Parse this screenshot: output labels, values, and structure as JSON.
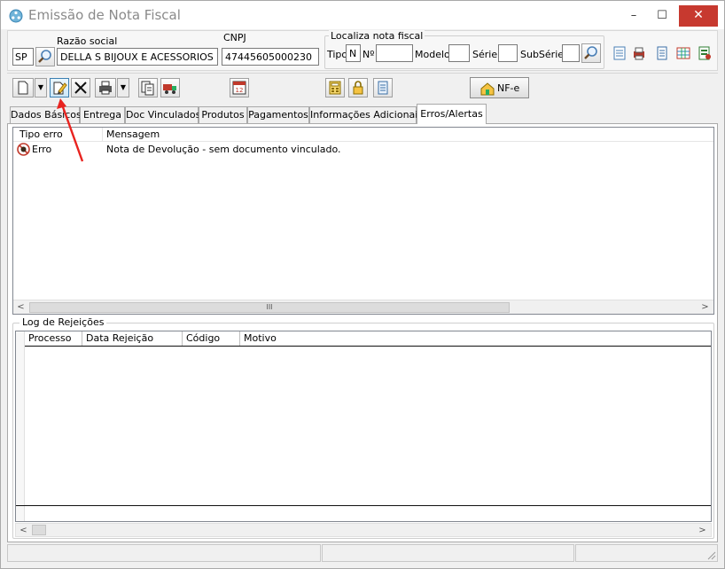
{
  "window": {
    "title": "Emissão de Nota Fiscal",
    "minimize": "–",
    "maximize": "☐",
    "close": "✕"
  },
  "header": {
    "uf": "SP",
    "razao_label": "Razão social",
    "razao_value": "DELLA S BIJOUX E ACESSORIOS LTD",
    "cnpj_label": "CNPJ",
    "cnpj_value": "47445605000230",
    "localiza": {
      "title": "Localiza nota fiscal",
      "tipo_label": "Tipo",
      "tipo_value": "N",
      "numero_label": "Nº",
      "modelo_label": "Modelo",
      "serie_label": "Série",
      "subserie_label": "SubSérie"
    }
  },
  "toolbar": {
    "nfe_label": "NF-e"
  },
  "tabs": [
    {
      "label": "Dados Básicos"
    },
    {
      "label": "Entrega"
    },
    {
      "label": "Doc Vinculados"
    },
    {
      "label": "Produtos"
    },
    {
      "label": "Pagamentos"
    },
    {
      "label": "Informações Adicionais"
    },
    {
      "label": "Erros/Alertas"
    }
  ],
  "errors": {
    "columns": [
      "Tipo erro",
      "Mensagem"
    ],
    "rows": [
      {
        "tipo": "Erro",
        "mensagem": "Nota de Devolução - sem documento vinculado."
      }
    ]
  },
  "rejeicoes": {
    "title": "Log de Rejeições",
    "columns": [
      "Processo",
      "Data Rejeição",
      "Código",
      "Motivo"
    ]
  },
  "scroll": {
    "left": "<",
    "right": ">",
    "thumb": "III"
  },
  "colors": {
    "close_bg": "#c7392f",
    "annotation_arrow": "#e8231f",
    "error_icon": "#c0392b"
  }
}
